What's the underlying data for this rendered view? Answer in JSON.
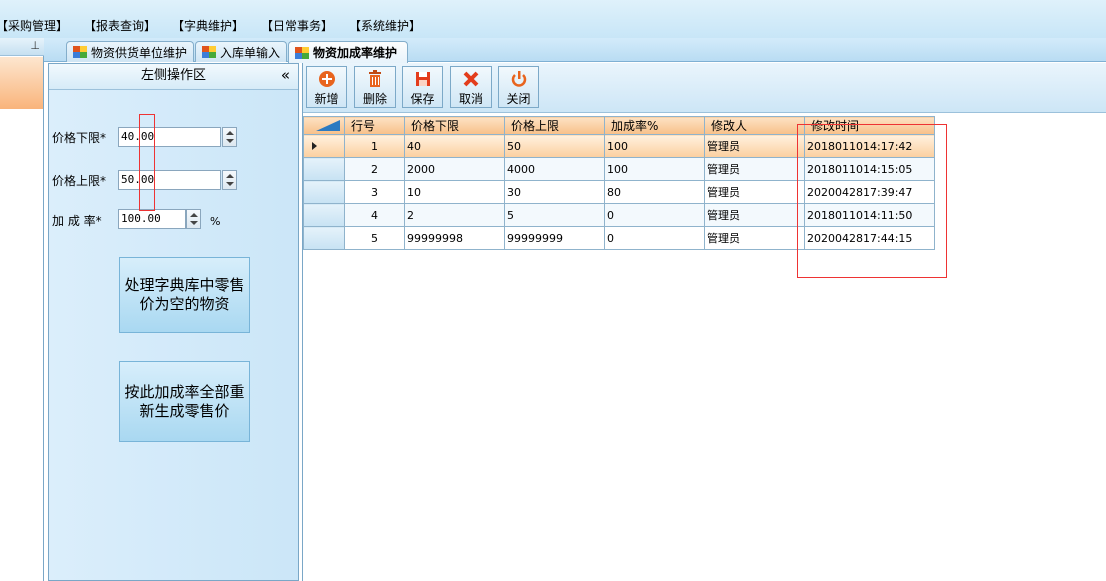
{
  "menu": {
    "items": [
      "【采购管理】",
      "【报表查询】",
      "【字典维护】",
      "【日常事务】",
      "【系统维护】"
    ]
  },
  "dock": {
    "pin_glyph": "⊥"
  },
  "tabs": [
    {
      "label": "物资供货单位维护",
      "active": false
    },
    {
      "label": "入库单输入",
      "active": false
    },
    {
      "label": "物资加成率维护",
      "active": true
    }
  ],
  "left_panel": {
    "title": "左侧操作区",
    "collapse_glyph": "«",
    "fields": {
      "price_low_label": "价格下限*",
      "price_low_value": "40.00",
      "price_high_label": "价格上限*",
      "price_high_value": "50.00",
      "rate_label": "加 成 率*",
      "rate_value": "100.00",
      "rate_unit": "%"
    },
    "buttons": {
      "process_empty": "处理字典库中零售价为空的物资",
      "regenerate": "按此加成率全部重新生成零售价"
    }
  },
  "toolbar": {
    "add": "新增",
    "delete": "删除",
    "save": "保存",
    "cancel": "取消",
    "close": "关闭"
  },
  "grid": {
    "columns": [
      "行号",
      "价格下限",
      "价格上限",
      "加成率%",
      "修改人",
      "修改时间"
    ],
    "rows": [
      {
        "no": "1",
        "low": "40",
        "high": "50",
        "rate": "100",
        "user": "管理员",
        "time": "2018011014:17:42"
      },
      {
        "no": "2",
        "low": "2000",
        "high": "4000",
        "rate": "100",
        "user": "管理员",
        "time": "2018011014:15:05"
      },
      {
        "no": "3",
        "low": "10",
        "high": "30",
        "rate": "80",
        "user": "管理员",
        "time": "2020042817:39:47"
      },
      {
        "no": "4",
        "low": "2",
        "high": "5",
        "rate": "0",
        "user": "管理员",
        "time": "2018011014:11:50"
      },
      {
        "no": "5",
        "low": "99999998",
        "high": "99999999",
        "rate": "0",
        "user": "管理员",
        "time": "2020042817:44:15"
      }
    ],
    "selected_row": 0
  },
  "colors": {
    "accent": "#2b7ac1",
    "highlight": "#e33333",
    "selection": "#fbcf9f"
  }
}
